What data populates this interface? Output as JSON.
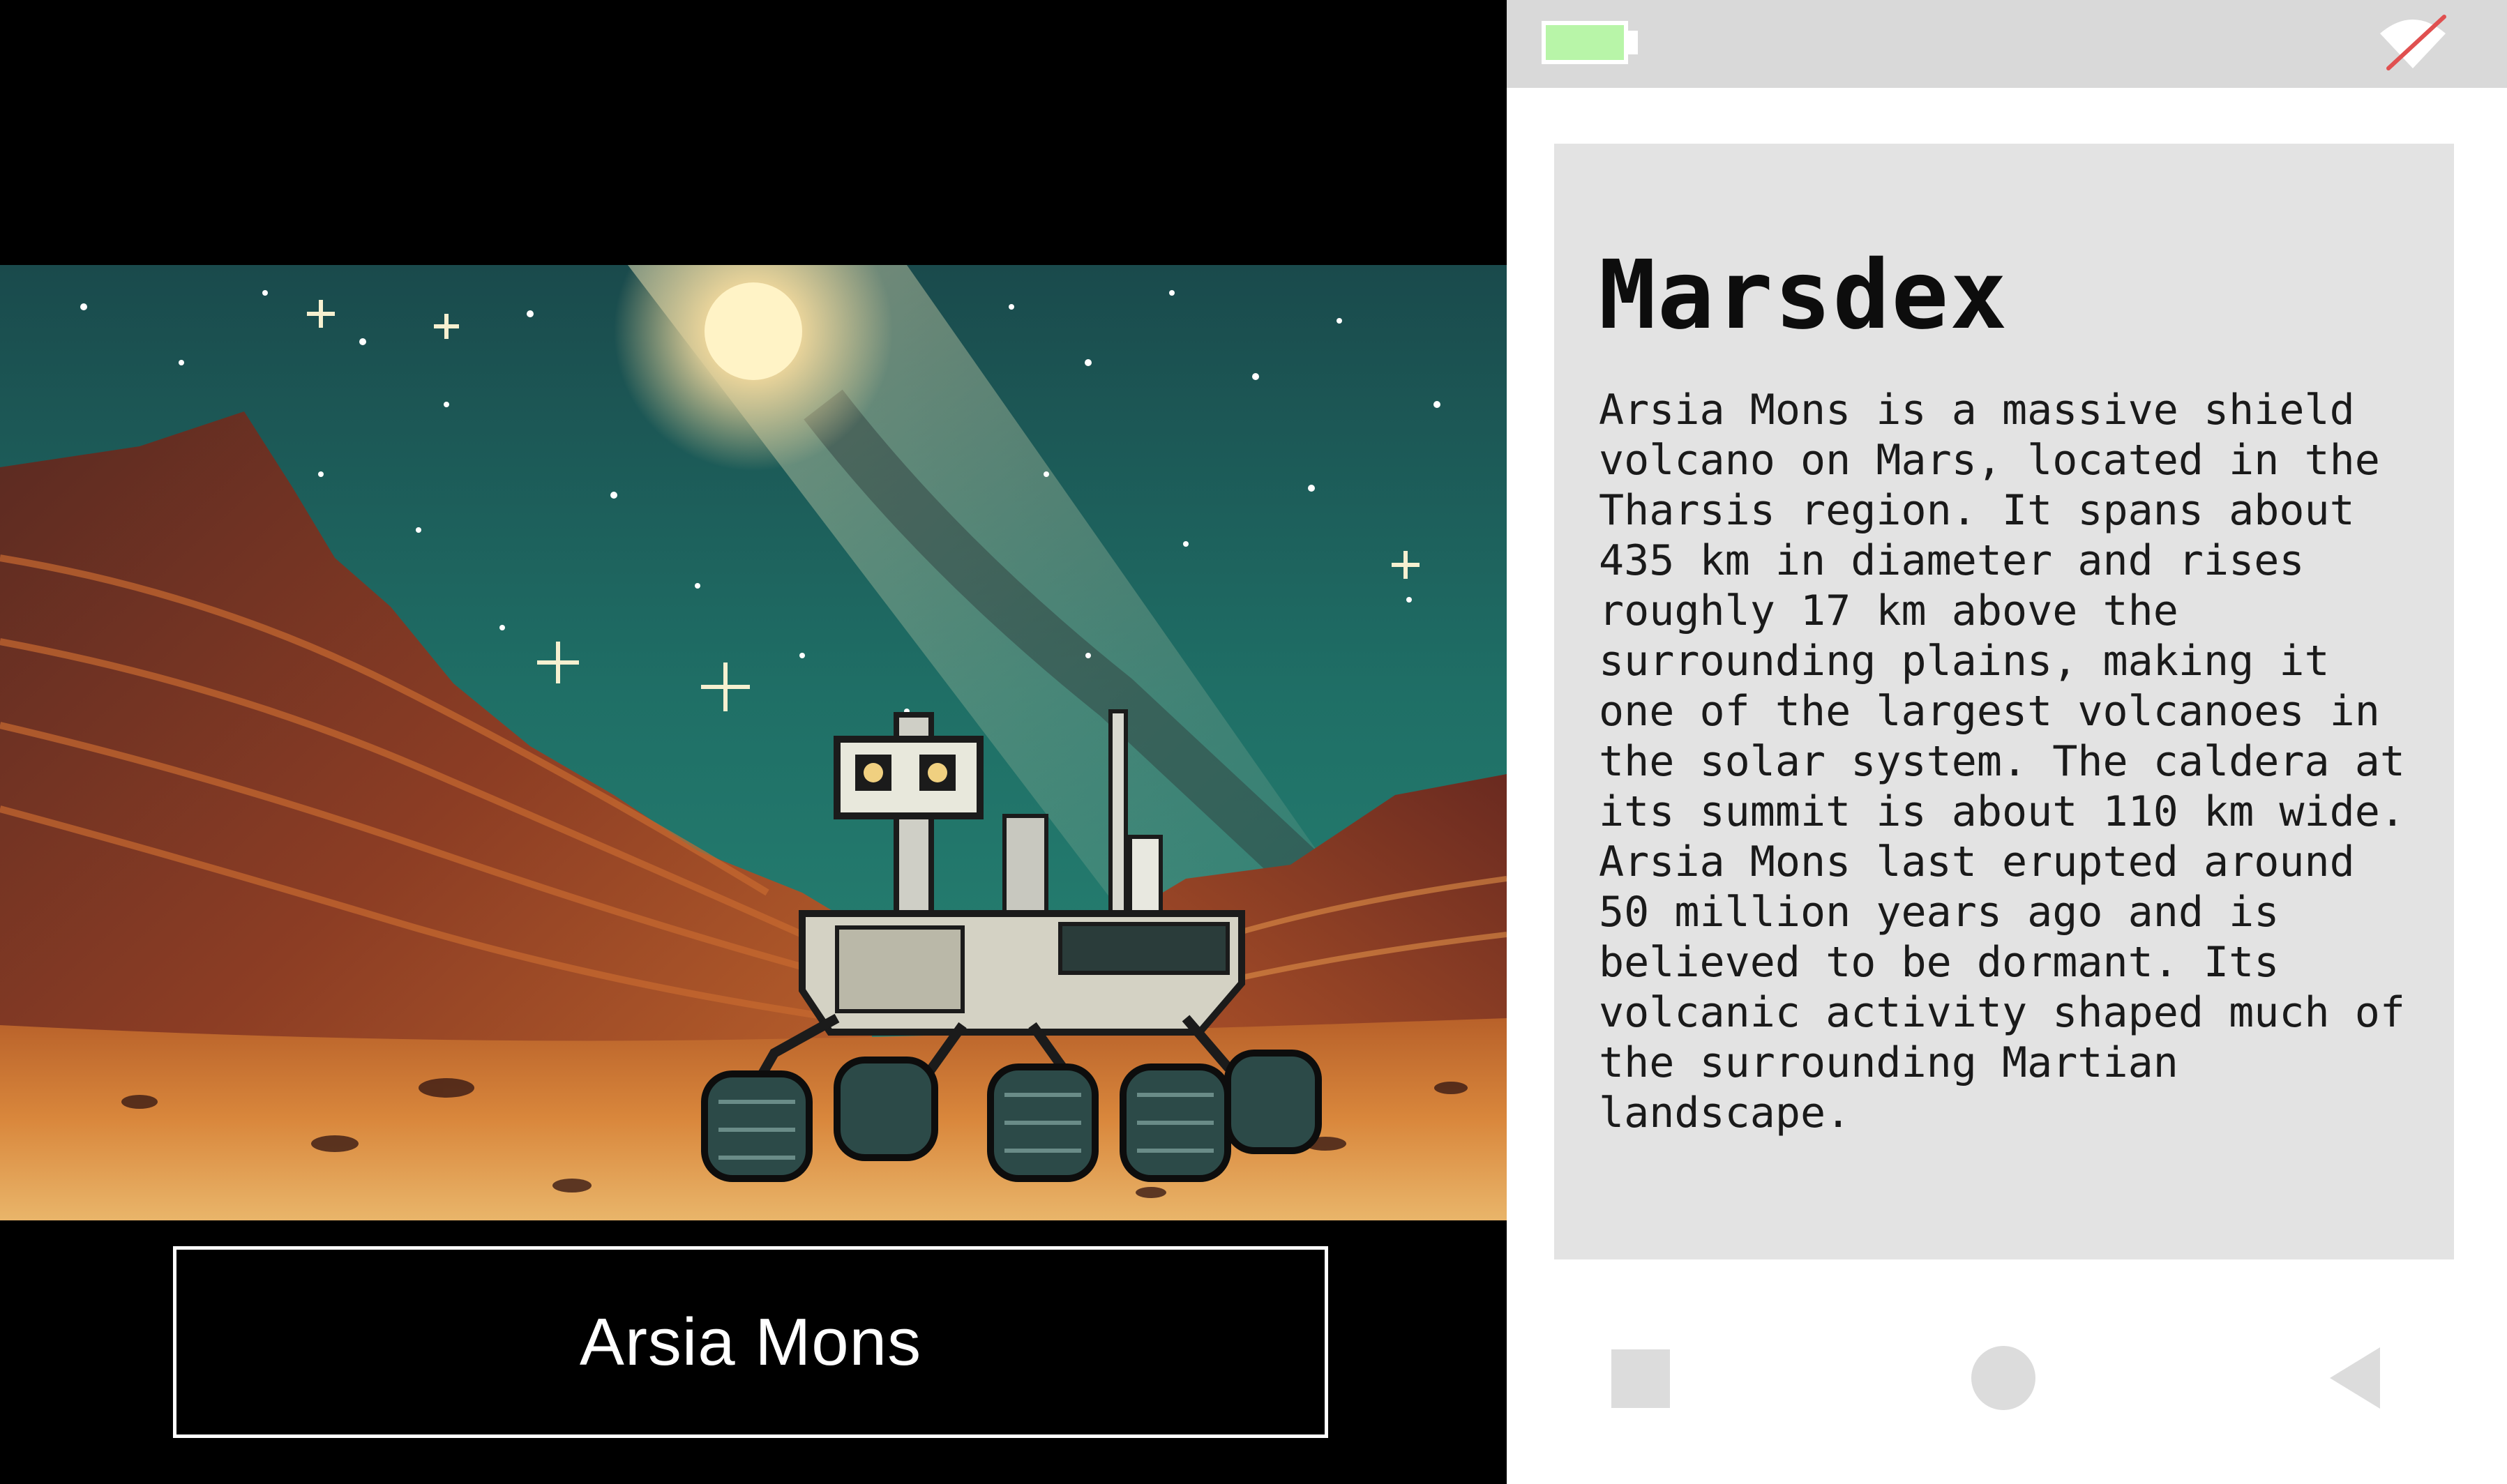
{
  "scene": {
    "location_name": "Arsia Mons"
  },
  "status_bar": {
    "battery_icon": "battery-icon",
    "battery_color": "#b8f5a8",
    "wifi_icon": "wifi-off-icon"
  },
  "card": {
    "title": "Marsdex",
    "description": "Arsia Mons is a massive shield volcano on Mars, located in the Tharsis region. It spans about 435 km in diameter and rises roughly 17 km above the surrounding plains, making it one of the largest volcanoes in the solar system. The caldera at its summit is about 110 km wide. Arsia Mons last erupted around 50 million years ago and is believed to be dormant. Its volcanic activity shaped much of the surrounding Martian landscape."
  },
  "nav": {
    "recents_icon": "square-icon",
    "home_icon": "circle-icon",
    "back_icon": "back-triangle-icon"
  }
}
